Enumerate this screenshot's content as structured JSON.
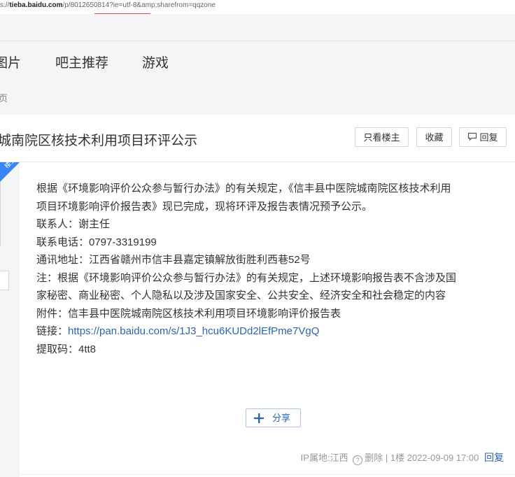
{
  "browser": {
    "url_prefix": "s://",
    "url_host": "tieba.baidu.com",
    "url_path": "/p/8012650814?ie=utf-8&amp;sharefrom=qqzone"
  },
  "nav": {
    "tabs": [
      {
        "label": "图片"
      },
      {
        "label": "吧主推荐"
      },
      {
        "label": "游戏"
      }
    ]
  },
  "breadcrumb": {
    "text": "页"
  },
  "thread": {
    "title": "城南院区核技术利用项目环评公示",
    "buttons": {
      "only_op": "只看楼主",
      "favorite": "收藏",
      "reply": "回复"
    },
    "op_badge": "楼主"
  },
  "post": {
    "lines": [
      "根据《环境影响评价公众参与暂行办法》的有关规定，《信丰县中医院城南院区核技术利用",
      "项目环境影响评价报告表》现已完成，现将环评及报告表情况预予公示。",
      "联系人：谢主任",
      "联系电话：0797-3319199",
      "通讯地址：江西省赣州市信丰县嘉定镇解放街胜利西巷52号",
      "注：根据《环境影响评价公众参与暂行办法》的有关规定，上述环境影响报告表不含涉及国",
      "家秘密、商业秘密、个人隐私以及涉及国家安全、公共安全、经济安全和社会稳定的内容",
      "附件：信丰县中医院城南院区核技术利用项目环境影响评价报告表"
    ],
    "link_label": "链接：",
    "link_url": "https://pan.baidu.com/s/1J3_hcu6KUDd2lEfPme7VgQ",
    "code_line": "提取码：4tt8",
    "share_label": "分享",
    "meta": {
      "ip_location": "IP属地:江西",
      "delete": "删除",
      "separator": "|",
      "floor": "1楼",
      "datetime": "2022-09-09 17:00",
      "reply": "回复"
    }
  },
  "colors": {
    "link": "#2d64b3",
    "badge": "#3a84f4",
    "background_gray": "#f4f5f7"
  }
}
